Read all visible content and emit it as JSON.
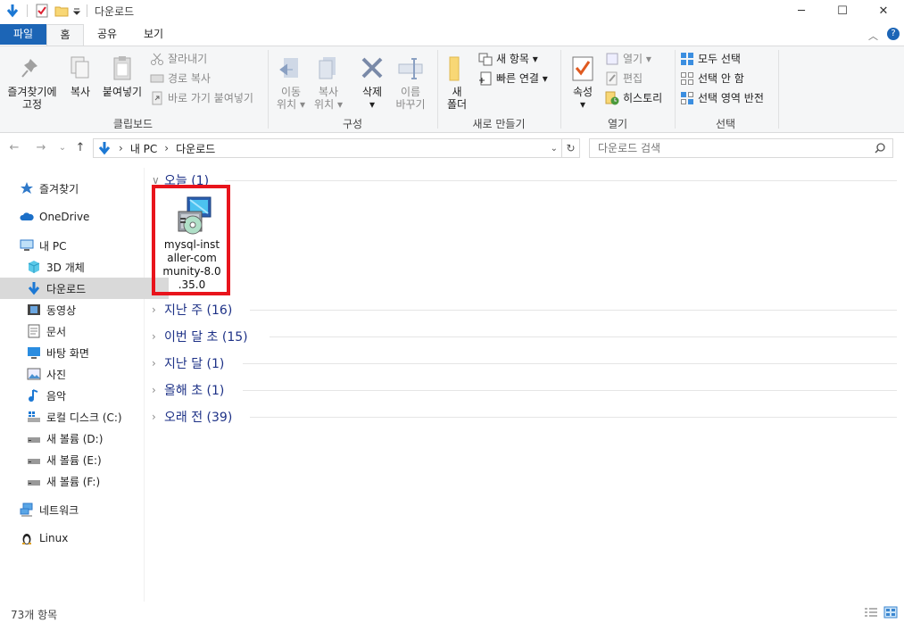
{
  "window": {
    "title": "다운로드",
    "minimize_icon": "minimize-icon",
    "maximize_icon": "maximize-icon",
    "close_icon": "close-icon"
  },
  "ribbon_tabs": {
    "file": "파일",
    "home": "홈",
    "share": "공유",
    "view": "보기"
  },
  "ribbon": {
    "clipboard": {
      "label": "클립보드",
      "pin": [
        "즐겨찾기에",
        "고정"
      ],
      "copy": "복사",
      "paste": "붙여넣기",
      "cut": "잘라내기",
      "copy_path": "경로 복사",
      "paste_shortcut": "바로 가기 붙여넣기"
    },
    "organize": {
      "label": "구성",
      "move_to": [
        "이동",
        "위치"
      ],
      "copy_to": [
        "복사",
        "위치"
      ],
      "delete": "삭제",
      "rename": [
        "이름",
        "바꾸기"
      ]
    },
    "new": {
      "label": "새로 만들기",
      "new_folder": [
        "새",
        "폴더"
      ],
      "new_item": "새 항목",
      "easy_access": "빠른 연결"
    },
    "open": {
      "label": "열기",
      "properties": "속성",
      "open": "열기",
      "edit": "편집",
      "history": "히스토리"
    },
    "select": {
      "label": "선택",
      "select_all": "모두 선택",
      "select_none": "선택 안 함",
      "invert": "선택 영역 반전"
    }
  },
  "address": {
    "path": [
      "내 PC",
      "다운로드"
    ],
    "search_placeholder": "다운로드 검색"
  },
  "nav": {
    "quick_access": "즐겨찾기",
    "onedrive": "OneDrive",
    "this_pc": "내 PC",
    "objects3d": "3D 개체",
    "downloads": "다운로드",
    "videos": "동영상",
    "documents": "문서",
    "desktop": "바탕 화면",
    "pictures": "사진",
    "music": "음악",
    "local_c": "로컬 디스크 (C:)",
    "vol_d": "새 볼륨 (D:)",
    "vol_e": "새 볼륨 (E:)",
    "vol_f": "새 볼륨 (F:)",
    "network": "네트워크",
    "linux": "Linux"
  },
  "groups": [
    {
      "label": "오늘 (1)"
    },
    {
      "label": "지난 주 (16)"
    },
    {
      "label": "이번 달 초 (15)"
    },
    {
      "label": "지난 달 (1)"
    },
    {
      "label": "올해 초 (1)"
    },
    {
      "label": "오래 전 (39)"
    }
  ],
  "file": {
    "name_lines": [
      "mysql-inst",
      "aller-com",
      "munity-8.0",
      ".35.0"
    ]
  },
  "status": {
    "count": "73개 항목"
  },
  "colors": {
    "accent": "#1c65b6",
    "highlight": "#e8141c",
    "group_text": "#1e3287"
  }
}
